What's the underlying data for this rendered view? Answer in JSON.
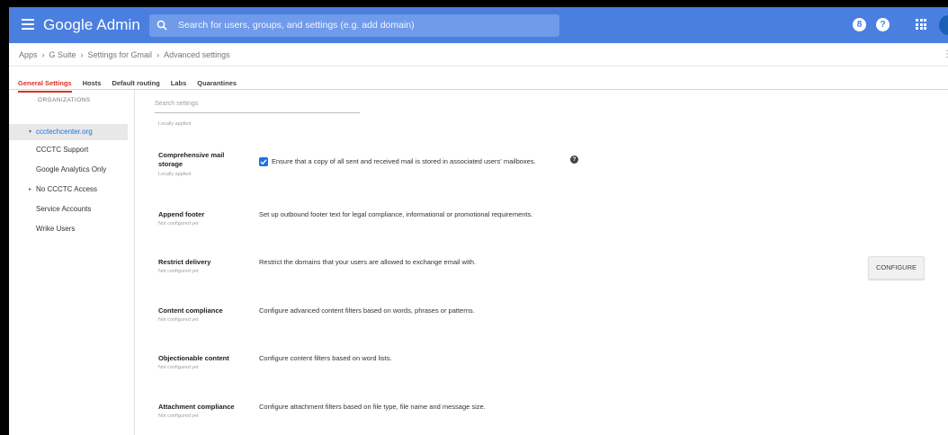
{
  "header": {
    "app_title": "Google Admin",
    "search_placeholder": "Search for users, groups, and settings (e.g. add domain)",
    "avatar_initial": "",
    "brand_color": "#4a7fe0"
  },
  "breadcrumb": {
    "items": [
      "Apps",
      "G Suite",
      "Settings for Gmail",
      "Advanced settings"
    ],
    "separator": "›"
  },
  "tabs": [
    {
      "label": "General Settings",
      "active": true
    },
    {
      "label": "Hosts",
      "active": false
    },
    {
      "label": "Default routing",
      "active": false
    },
    {
      "label": "Labs",
      "active": false
    },
    {
      "label": "Quarantines",
      "active": false
    }
  ],
  "sidebar": {
    "heading": "ORGANIZATIONS",
    "items": [
      {
        "label": "ccctechcenter.org",
        "selected": true,
        "expand": "▾"
      },
      {
        "label": "CCCTC Support",
        "selected": false
      },
      {
        "label": "Google Analytics Only",
        "selected": false
      },
      {
        "label": "No CCCTC Access",
        "selected": false,
        "expand": "▸"
      },
      {
        "label": "Service Accounts",
        "selected": false
      },
      {
        "label": "Wrike Users",
        "selected": false
      }
    ]
  },
  "main": {
    "search_placeholder": "Search settings",
    "top_status": "Locally applied",
    "settings": [
      {
        "title_line1": "Comprehensive mail",
        "title_line2": "storage",
        "status": "Locally applied",
        "description": "Ensure that a copy of all sent and received mail is stored in associated users' mailboxes.",
        "checked": true
      },
      {
        "title_line1": "Append footer",
        "title_line2": "",
        "status": "Not configured yet",
        "description": "Set up outbound footer text for legal compliance, informational or promotional requirements."
      },
      {
        "title_line1": "Restrict delivery",
        "title_line2": "",
        "status": "Not configured yet",
        "description": "Restrict the domains that your users are allowed to exchange email with."
      },
      {
        "title_line1": "Content compliance",
        "title_line2": "",
        "status": "Not configured yet",
        "description": "Configure advanced content filters based on words, phrases or patterns."
      },
      {
        "title_line1": "Objectionable content",
        "title_line2": "",
        "status": "Not configured yet",
        "description": "Configure content filters based on word lists."
      },
      {
        "title_line1": "Attachment compliance",
        "title_line2": "",
        "status": "Not configured yet",
        "description": "Configure attachment filters based on file type, file name and message size."
      }
    ],
    "configure_label": "CONFIGURE"
  }
}
